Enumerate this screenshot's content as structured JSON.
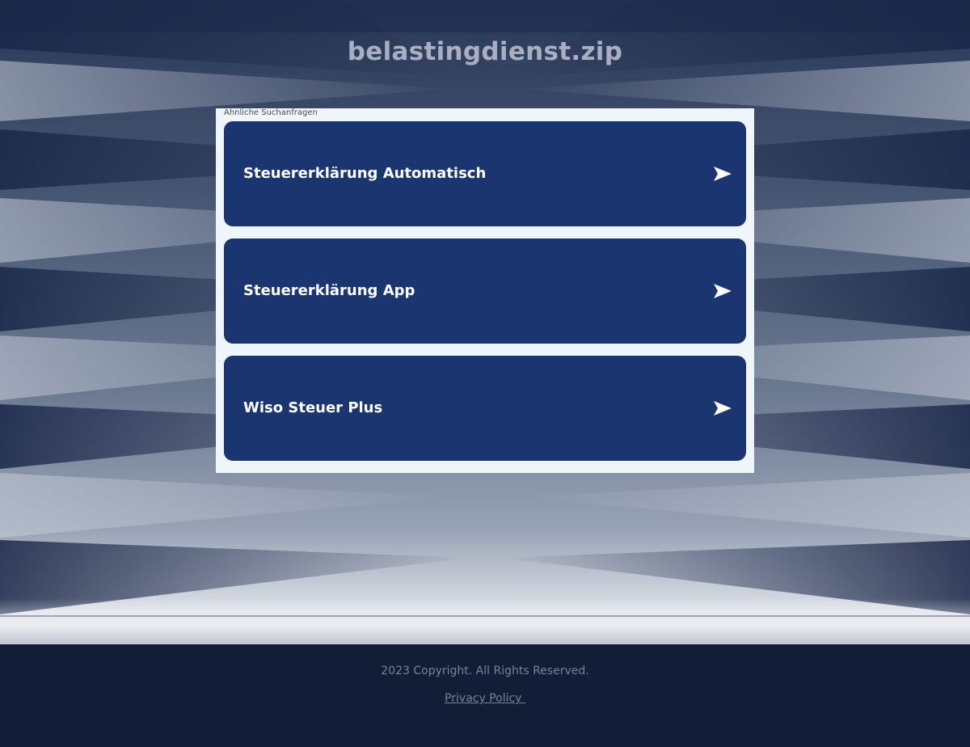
{
  "site": {
    "title": "belastingdienst.zip"
  },
  "related": {
    "label": "Ähnliche Suchanfragen",
    "items": [
      {
        "label": "Steuererklärung Automatisch"
      },
      {
        "label": "Steuererklärung App"
      },
      {
        "label": "Wiso Steuer Plus"
      }
    ]
  },
  "footer": {
    "copyright": "2023 Copyright. All Rights Reserved.",
    "privacy_label": "Privacy Policy "
  },
  "colors": {
    "link_bg": "#1b3571",
    "box_bg": "#eef6fc",
    "footer_bg": "#121d38",
    "title": "#a9afc1"
  },
  "icons": {
    "result_arrow": "arrow-right-icon"
  }
}
